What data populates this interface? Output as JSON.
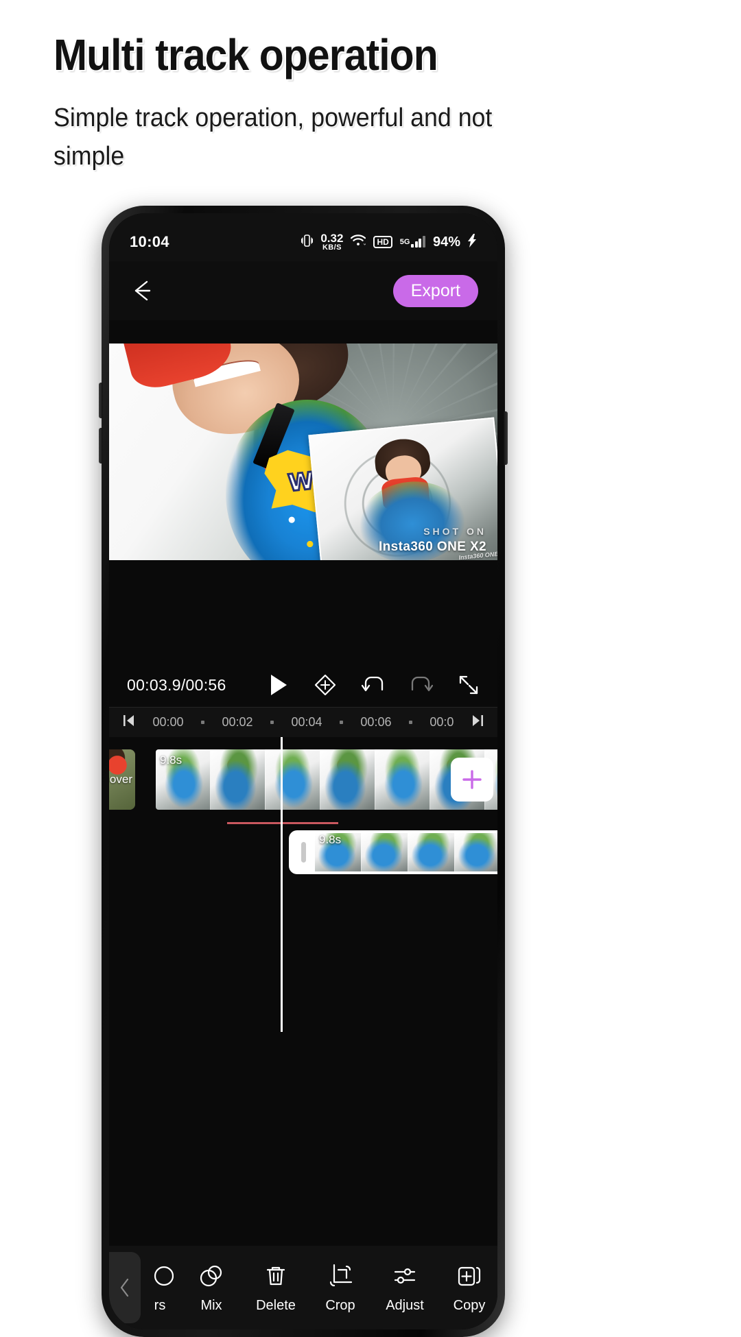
{
  "promo": {
    "title": "Multi track operation",
    "subtitle": "Simple track operation, powerful and not simple"
  },
  "colors": {
    "accent": "#c96ae8",
    "screen_bg": "#0a0a0a",
    "statusbar_bg": "#111111",
    "playhead": "#ffffff",
    "keyframe_line": "#c9585f"
  },
  "status_bar": {
    "time": "10:04",
    "network_speed_value": "0.32",
    "network_speed_unit": "KB/S",
    "hd_badge": "HD",
    "network_type": "5G",
    "battery": "94%",
    "icons": [
      "vibrate-icon",
      "wifi-icon",
      "hd-icon",
      "signal-bars-icon",
      "charging-bolt-icon"
    ]
  },
  "app_nav": {
    "back_icon": "back-arrow-icon",
    "export_label": "Export"
  },
  "preview": {
    "sticker_text": "WOW",
    "watermark_line1": "SHOT ON",
    "watermark_line2": "Insta360 ONE X2",
    "pip_watermark": "Insta360 ONE"
  },
  "player": {
    "timecode": "00:03.9/00:56",
    "controls": [
      {
        "name": "play-button",
        "icon": "play-icon"
      },
      {
        "name": "keyframe-button",
        "icon": "keyframe-add-icon"
      },
      {
        "name": "undo-button",
        "icon": "undo-icon"
      },
      {
        "name": "redo-button",
        "icon": "redo-icon"
      },
      {
        "name": "fullscreen-button",
        "icon": "fullscreen-icon"
      }
    ]
  },
  "ruler": {
    "skip_start_icon": "skip-to-start-icon",
    "skip_end_icon": "skip-to-end-icon",
    "ticks": [
      "00:00",
      "00:02",
      "00:04",
      "00:06",
      "00:0"
    ]
  },
  "timeline": {
    "cover_label": "over",
    "main_clip_duration": "9.8s",
    "pip_clip_duration": "9.8s",
    "add_clip_icon": "plus-icon"
  },
  "toolbar": {
    "collapse_icon": "chevron-left-icon",
    "items": [
      {
        "label": "rs",
        "icon": "filters-icon",
        "name": "tool-filters"
      },
      {
        "label": "Mix",
        "icon": "mix-icon",
        "name": "tool-mix"
      },
      {
        "label": "Delete",
        "icon": "trash-icon",
        "name": "tool-delete"
      },
      {
        "label": "Crop",
        "icon": "crop-icon",
        "name": "tool-crop"
      },
      {
        "label": "Adjust",
        "icon": "sliders-icon",
        "name": "tool-adjust"
      },
      {
        "label": "Copy",
        "icon": "copy-icon",
        "name": "tool-copy"
      }
    ]
  }
}
